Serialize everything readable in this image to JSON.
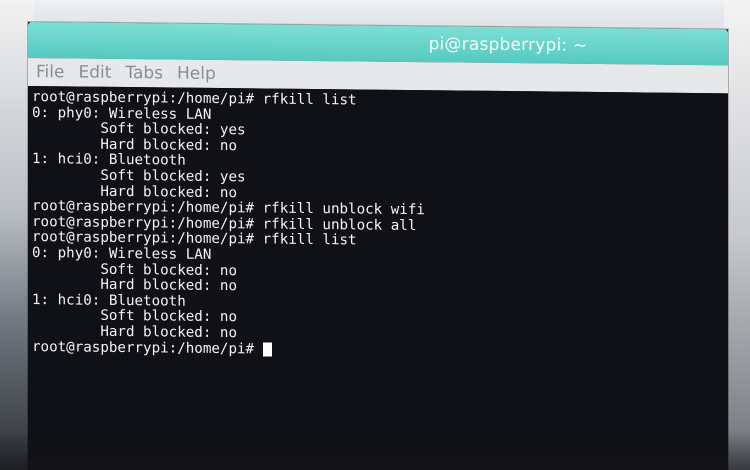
{
  "window": {
    "title": "pi@raspberrypi: ~"
  },
  "menubar": {
    "items": [
      "File",
      "Edit",
      "Tabs",
      "Help"
    ]
  },
  "terminal": {
    "lines": [
      "root@raspberrypi:/home/pi# rfkill list",
      "0: phy0: Wireless LAN",
      "        Soft blocked: yes",
      "        Hard blocked: no",
      "1: hci0: Bluetooth",
      "        Soft blocked: yes",
      "        Hard blocked: no",
      "root@raspberrypi:/home/pi# rfkill unblock wifi",
      "root@raspberrypi:/home/pi# rfkill unblock all",
      "root@raspberrypi:/home/pi# rfkill list",
      "0: phy0: Wireless LAN",
      "        Soft blocked: no",
      "        Hard blocked: no",
      "1: hci0: Bluetooth",
      "        Soft blocked: no",
      "        Hard blocked: no"
    ],
    "prompt": "root@raspberrypi:/home/pi# "
  },
  "colors": {
    "titlebar": "#5ccbc2",
    "terminal_bg": "#0f1116",
    "terminal_fg": "#f4f4f4",
    "menubar_bg": "#e6e8ea"
  }
}
